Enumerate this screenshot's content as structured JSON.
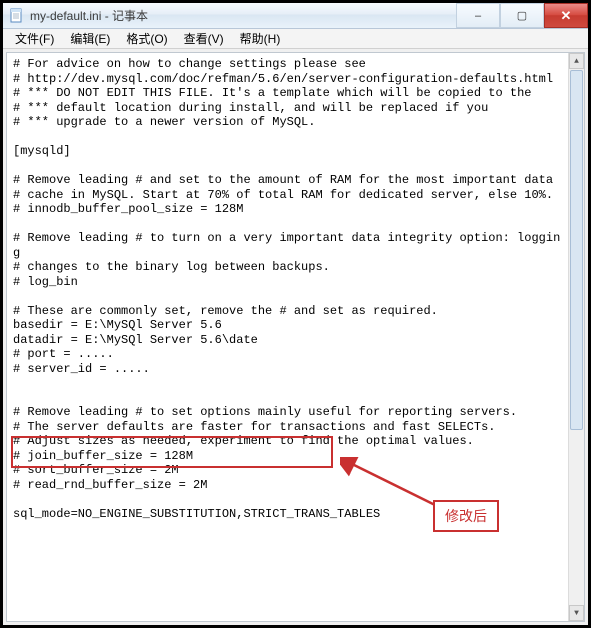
{
  "window": {
    "title": "my-default.ini - 记事本",
    "buttons": {
      "minimize": "–",
      "maximize": "▢",
      "close": "✕"
    }
  },
  "menubar": {
    "file": "文件(F)",
    "edit": "编辑(E)",
    "format": "格式(O)",
    "view": "查看(V)",
    "help": "帮助(H)"
  },
  "annotation": {
    "label": "修改后"
  },
  "scrollbar": {
    "up": "▲",
    "down": "▼"
  },
  "file_content": {
    "l01": "# For advice on how to change settings please see",
    "l02": "# http://dev.mysql.com/doc/refman/5.6/en/server-configuration-defaults.html",
    "l03": "# *** DO NOT EDIT THIS FILE. It's a template which will be copied to the",
    "l04": "# *** default location during install, and will be replaced if you",
    "l05": "# *** upgrade to a newer version of MySQL.",
    "l06": "",
    "l07": "[mysqld]",
    "l08": "",
    "l09": "# Remove leading # and set to the amount of RAM for the most important data",
    "l10": "# cache in MySQL. Start at 70% of total RAM for dedicated server, else 10%.",
    "l11": "# innodb_buffer_pool_size = 128M",
    "l12": "",
    "l13": "# Remove leading # to turn on a very important data integrity option: logging",
    "l14": "# changes to the binary log between backups.",
    "l15": "# log_bin",
    "l16": "",
    "l17": "# These are commonly set, remove the # and set as required.",
    "l18": "basedir = E:\\MySQl Server 5.6",
    "l19": "datadir = E:\\MySQl Server 5.6\\date",
    "l20": "# port = .....",
    "l21": "# server_id = .....",
    "l22": "",
    "l23": "",
    "l24": "# Remove leading # to set options mainly useful for reporting servers.",
    "l25": "# The server defaults are faster for transactions and fast SELECTs.",
    "l26": "# Adjust sizes as needed, experiment to find the optimal values.",
    "l27": "# join_buffer_size = 128M",
    "l28": "# sort_buffer_size = 2M",
    "l29": "# read_rnd_buffer_size = 2M",
    "l30": "",
    "l31": "sql_mode=NO_ENGINE_SUBSTITUTION,STRICT_TRANS_TABLES"
  }
}
